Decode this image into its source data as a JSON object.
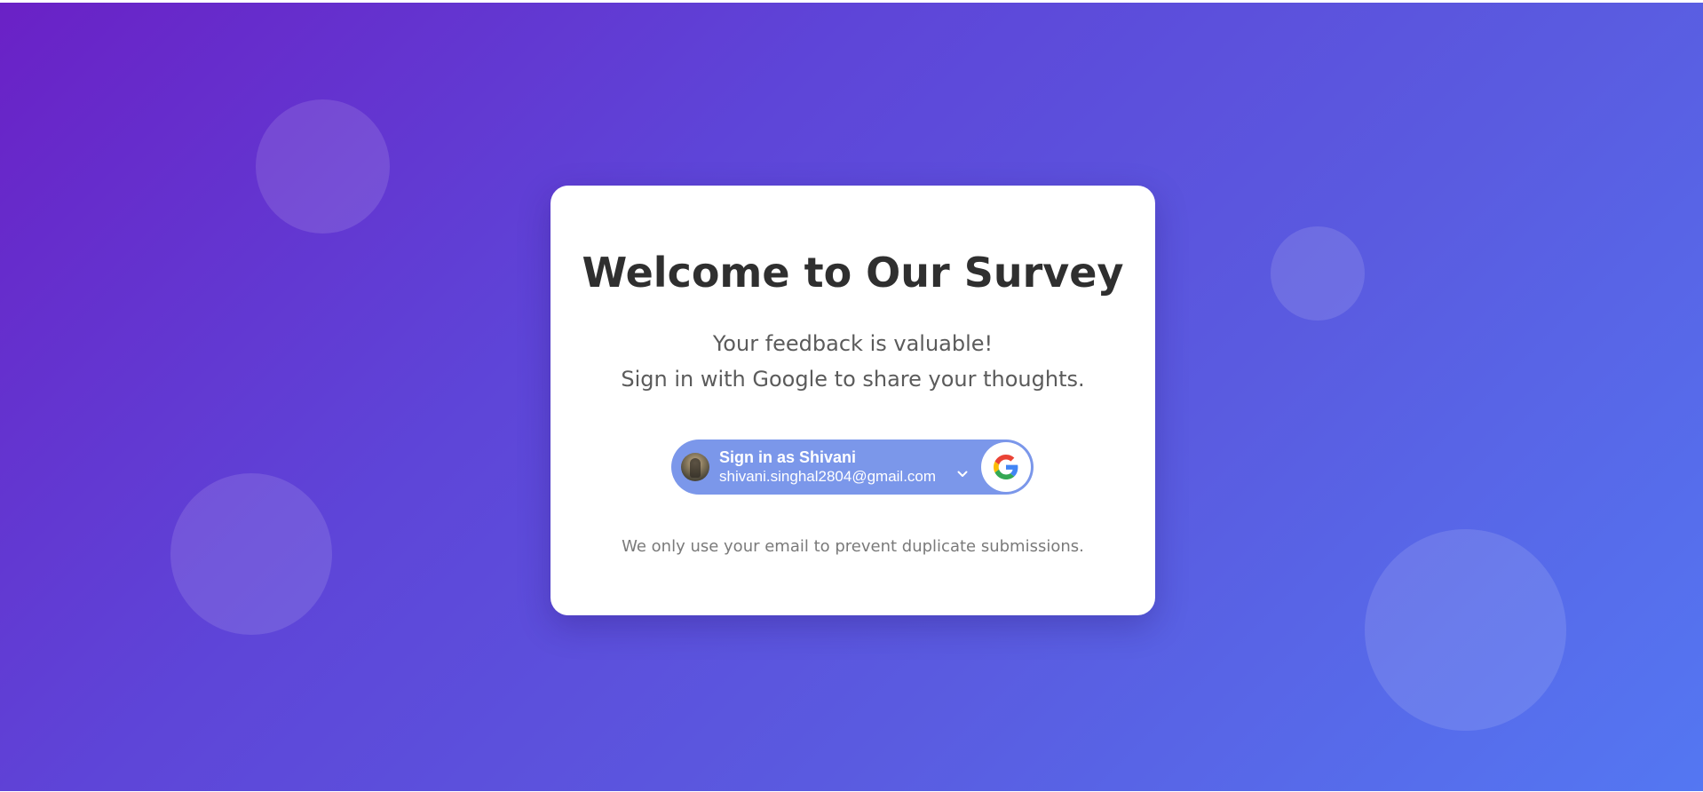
{
  "card": {
    "title": "Welcome to Our Survey",
    "subtitle_line1": "Your feedback is valuable!",
    "subtitle_line2": "Sign in with Google to share your thoughts.",
    "note": "We only use your email to prevent duplicate submissions."
  },
  "google_button": {
    "label": "Sign in as Shivani",
    "email": "shivani.singhal2804@gmail.com",
    "icon": "google-logo-icon",
    "accent_color": "#7b97ea"
  },
  "theme": {
    "gradient_start": "#6a21c6",
    "gradient_end": "#5477f2"
  }
}
